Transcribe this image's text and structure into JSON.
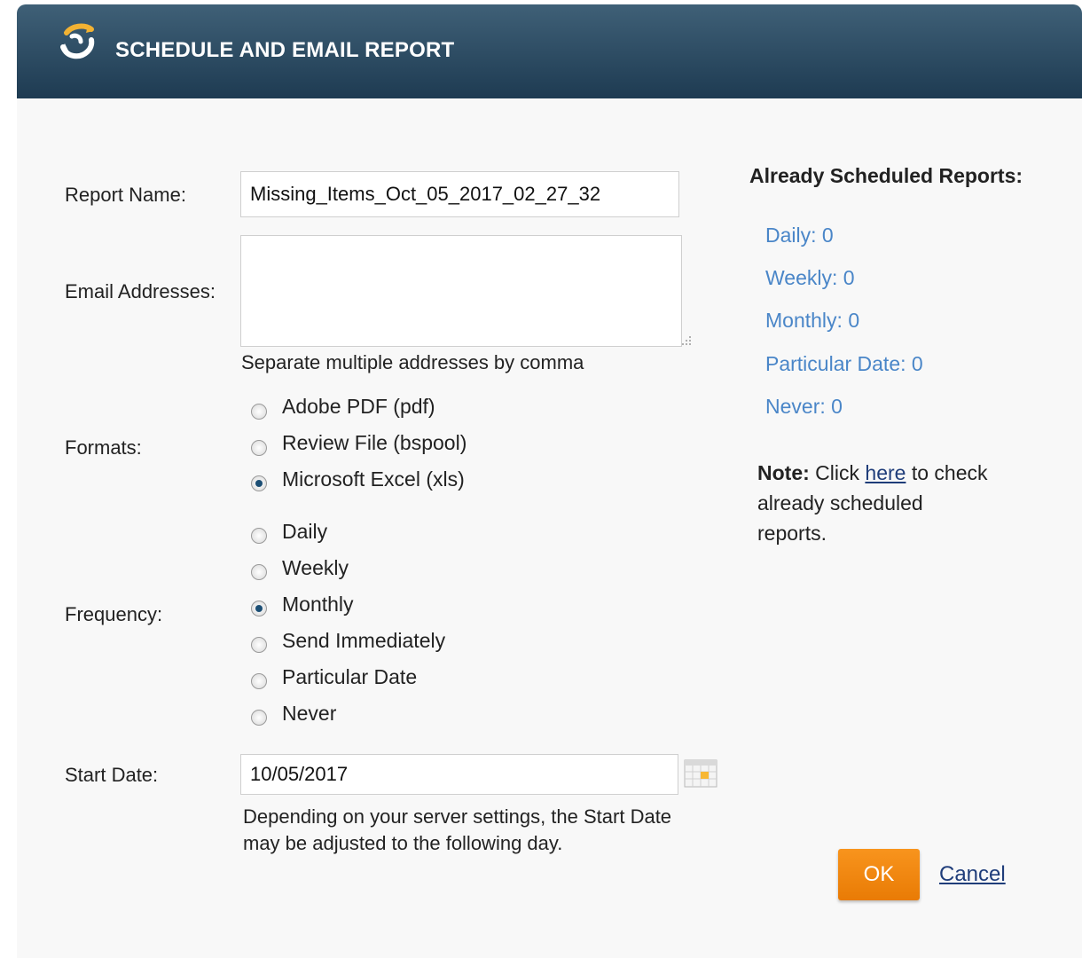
{
  "header": {
    "title": "SCHEDULE AND EMAIL REPORT",
    "logo_icon": "refresh-swirl-logo"
  },
  "form": {
    "report_name_label": "Report Name:",
    "report_name_value": "Missing_Items_Oct_05_2017_02_27_32",
    "email_label": "Email Addresses:",
    "email_value": "",
    "email_hint": "Separate multiple addresses by comma",
    "formats_label": "Formats:",
    "formats": [
      {
        "label": "Adobe PDF (pdf)",
        "checked": false
      },
      {
        "label": "Review File (bspool)",
        "checked": false
      },
      {
        "label": "Microsoft Excel (xls)",
        "checked": true
      }
    ],
    "frequency_label": "Frequency:",
    "frequency": [
      {
        "label": "Daily",
        "checked": false
      },
      {
        "label": "Weekly",
        "checked": false
      },
      {
        "label": "Monthly",
        "checked": true
      },
      {
        "label": "Send Immediately",
        "checked": false
      },
      {
        "label": "Particular Date",
        "checked": false
      },
      {
        "label": "Never",
        "checked": false
      }
    ],
    "start_date_label": "Start Date:",
    "start_date_value": "10/05/2017",
    "start_date_hint_line1": "Depending on your server settings, the Start Date",
    "start_date_hint_line2": "may be adjusted to the following day."
  },
  "sidebar": {
    "heading": "Already Scheduled Reports:",
    "links": [
      "Daily: 0",
      "Weekly: 0",
      "Monthly: 0",
      "Particular Date: 0",
      "Never: 0"
    ],
    "note_bold": "Note:",
    "note_text1": " Click ",
    "note_link": "here",
    "note_text2": " to check",
    "note_line2": "already scheduled",
    "note_line3": "reports."
  },
  "actions": {
    "ok_label": "OK",
    "cancel_label": "Cancel"
  },
  "colors": {
    "header_top": "#3f6077",
    "header_bottom": "#1e3b52",
    "ok_button": "#f08a12",
    "link": "#4a86c8"
  }
}
